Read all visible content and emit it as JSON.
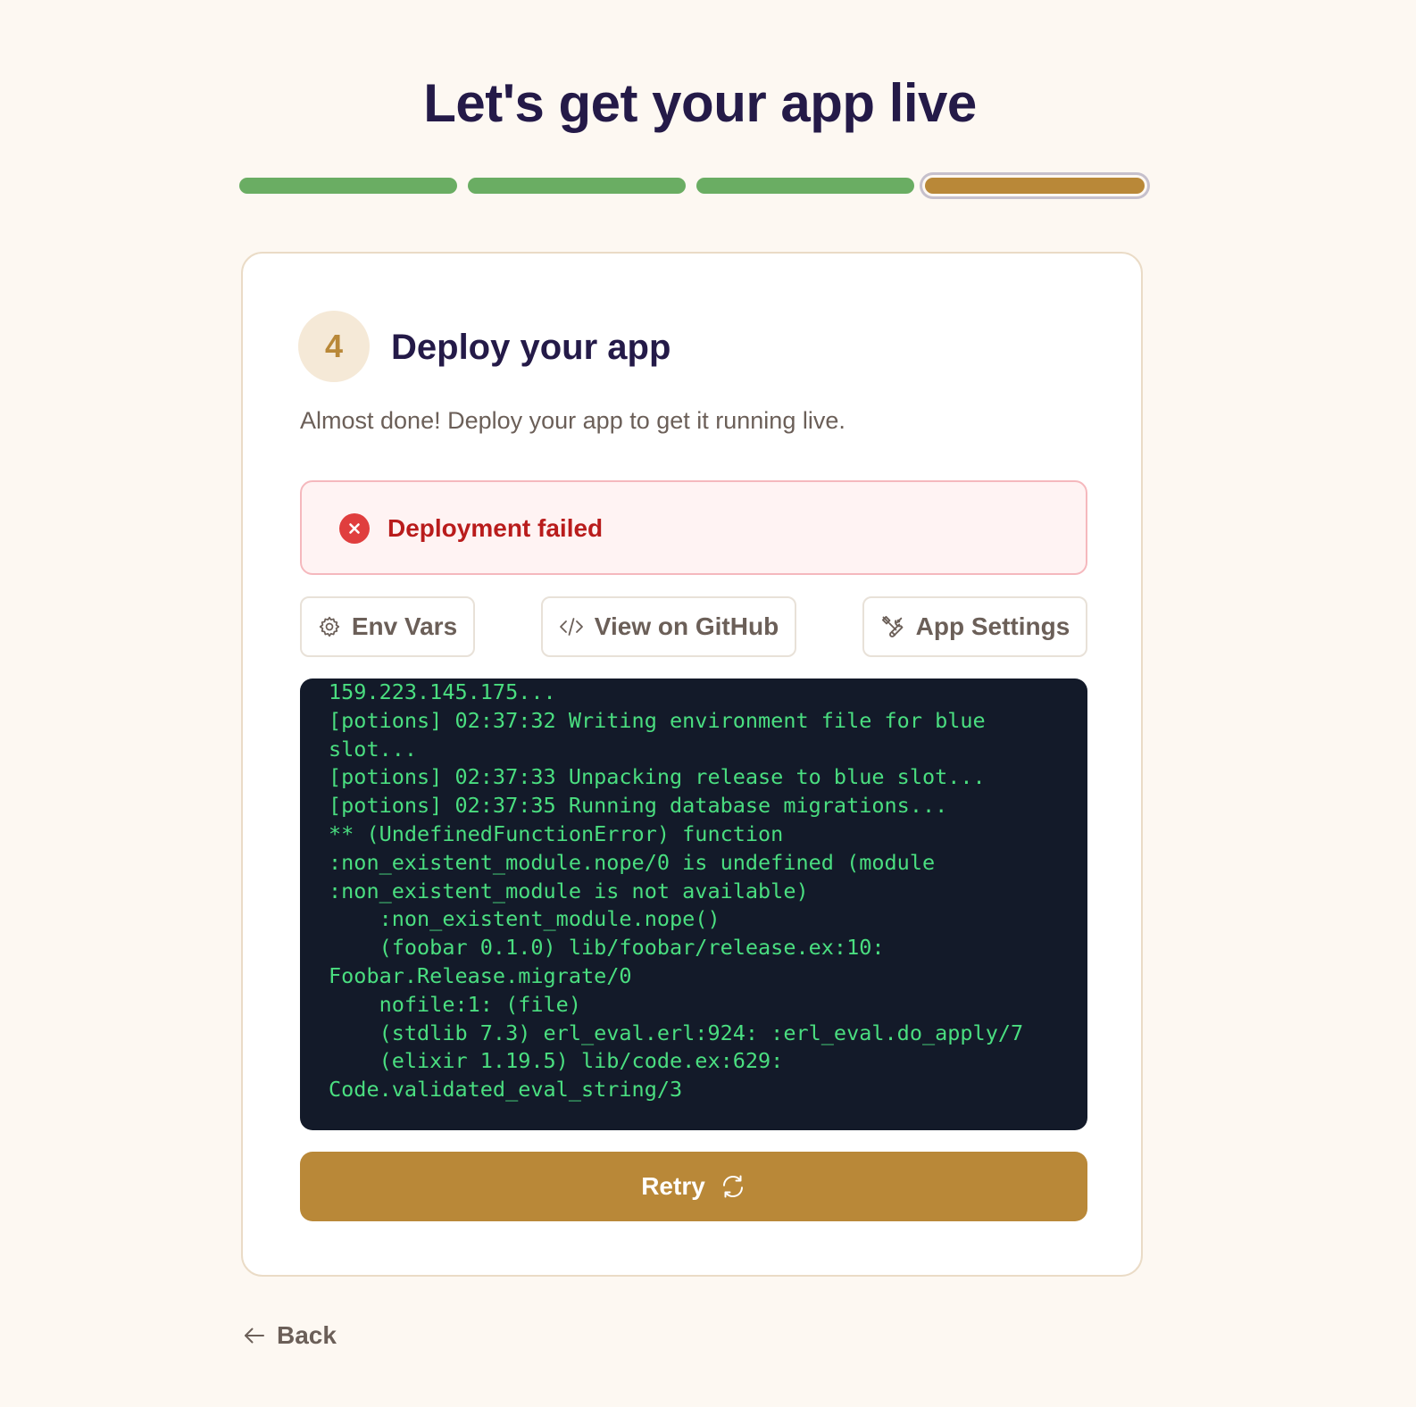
{
  "header": {
    "title": "Let's get your app live"
  },
  "progress": {
    "total_steps": 4,
    "completed_steps": 3,
    "current_step": 4
  },
  "step": {
    "number": "4",
    "title": "Deploy your app",
    "description": "Almost done! Deploy your app to get it running live."
  },
  "alert": {
    "icon": "error-x-icon",
    "text": "Deployment failed"
  },
  "actions": {
    "env_vars": {
      "label": "Env Vars",
      "icon": "gear-icon"
    },
    "github": {
      "label": "View on GitHub",
      "icon": "code-icon"
    },
    "app_settings": {
      "label": "App Settings",
      "icon": "tools-icon"
    }
  },
  "log": {
    "lines": [
      "159.223.145.175...",
      "[potions] 02:37:32 Writing environment file for blue",
      "slot...",
      "[potions] 02:37:33 Unpacking release to blue slot...",
      "[potions] 02:37:35 Running database migrations...",
      "** (UndefinedFunctionError) function",
      ":non_existent_module.nope/0 is undefined (module",
      ":non_existent_module is not available)",
      "    :non_existent_module.nope()",
      "    (foobar 0.1.0) lib/foobar/release.ex:10:",
      "Foobar.Release.migrate/0",
      "    nofile:1: (file)",
      "    (stdlib 7.3) erl_eval.erl:924: :erl_eval.do_apply/7",
      "    (elixir 1.19.5) lib/code.ex:629:",
      "Code.validated_eval_string/3"
    ]
  },
  "retry": {
    "label": "Retry",
    "icon": "refresh-icon"
  },
  "back": {
    "label": "Back",
    "icon": "arrow-left-icon"
  },
  "colors": {
    "title": "#241a48",
    "accent": "#b98838",
    "done": "#6aad63",
    "error": "#b91c1c",
    "terminal_bg": "#131a29",
    "terminal_text": "#4ade80",
    "page_bg": "#fdf8f2"
  }
}
